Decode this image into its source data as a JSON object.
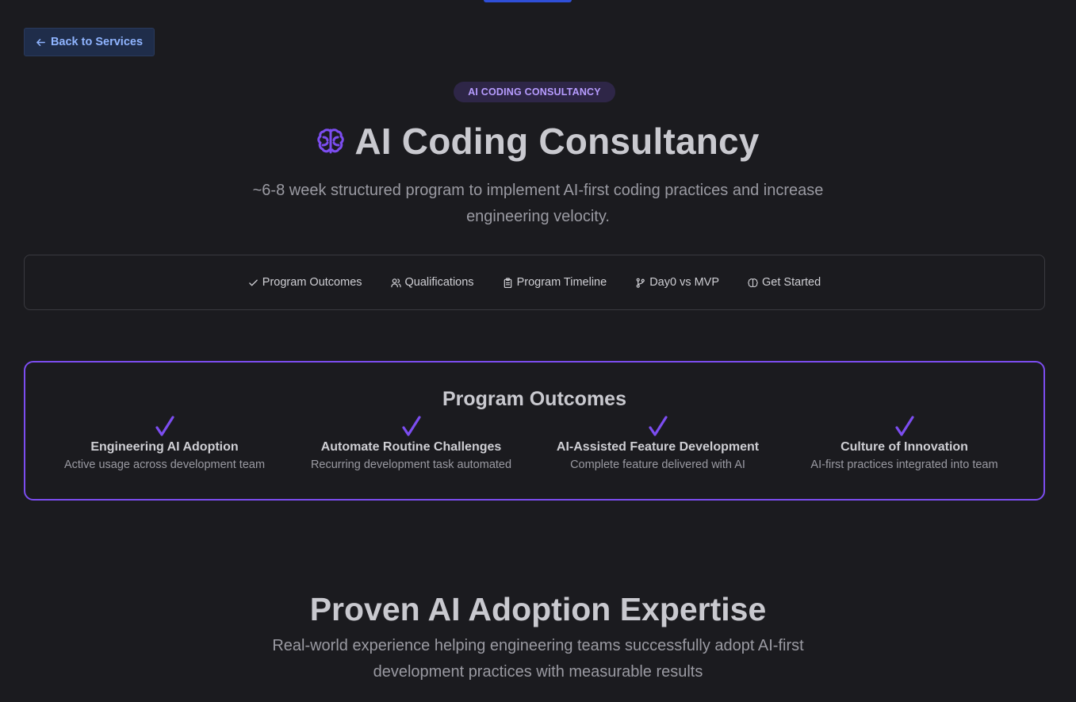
{
  "nav": {
    "back_label": "Back to Services"
  },
  "hero": {
    "badge": "AI CODING CONSULTANCY",
    "title": "AI Coding Consultancy",
    "subtitle": "~6-8 week structured program to implement AI-first coding practices and increase engineering velocity.",
    "icon": "brain-icon"
  },
  "section_nav": {
    "items": [
      {
        "label": "Program Outcomes",
        "icon": "check-icon"
      },
      {
        "label": "Qualifications",
        "icon": "users-icon"
      },
      {
        "label": "Program Timeline",
        "icon": "clipboard-icon"
      },
      {
        "label": "Day0 vs MVP",
        "icon": "git-branch-icon"
      },
      {
        "label": "Get Started",
        "icon": "brain-icon"
      }
    ]
  },
  "outcomes": {
    "title": "Program Outcomes",
    "items": [
      {
        "title": "Engineering AI Adoption",
        "description": "Active usage across development team"
      },
      {
        "title": "Automate Routine Challenges",
        "description": "Recurring development task automated"
      },
      {
        "title": "AI-Assisted Feature Development",
        "description": "Complete feature delivered with AI"
      },
      {
        "title": "Culture of Innovation",
        "description": "AI-first practices integrated into team"
      }
    ]
  },
  "expertise": {
    "title": "Proven AI Adoption Expertise",
    "subtitle": "Real-world experience helping engineering teams successfully adopt AI-first development practices with measurable results"
  },
  "colors": {
    "background": "#1b1b1f",
    "accent": "#7c4df0",
    "link": "#8fb4ff",
    "top_bar": "#2f4fd8"
  }
}
